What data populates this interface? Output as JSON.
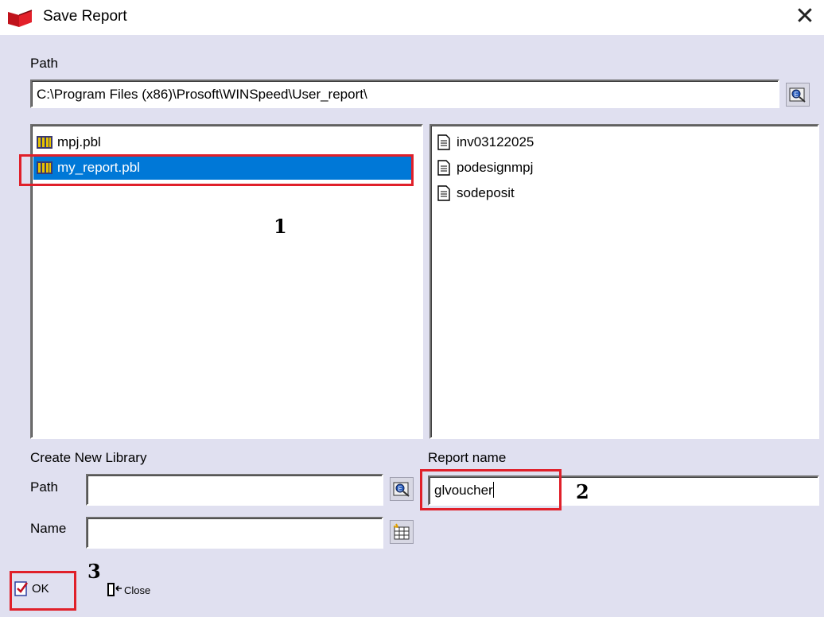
{
  "window": {
    "title": "Save Report",
    "close_glyph": "✕"
  },
  "path": {
    "label": "Path",
    "value": "C:\\Program Files (x86)\\Prosoft\\WINSpeed\\User_report\\"
  },
  "libraries": [
    {
      "name": "mpj.pbl",
      "icon": "library-icon",
      "selected": false
    },
    {
      "name": "my_report.pbl",
      "icon": "library-icon",
      "selected": true
    }
  ],
  "reports": [
    {
      "name": "inv03122025",
      "icon": "report-icon"
    },
    {
      "name": "podesignmpj",
      "icon": "report-icon"
    },
    {
      "name": "sodeposit",
      "icon": "report-icon"
    }
  ],
  "create_library": {
    "title": "Create New Library",
    "path_label": "Path",
    "path_value": "",
    "name_label": "Name",
    "name_value": ""
  },
  "report_name": {
    "label": "Report name",
    "value": "glvoucher"
  },
  "buttons": {
    "ok": "OK",
    "close": "Close"
  },
  "annotations": {
    "one": "1",
    "two": "2",
    "three": "3"
  },
  "colors": {
    "selection": "#0078d7",
    "annotation_red": "#e0202a",
    "background": "#e0e0f0"
  }
}
